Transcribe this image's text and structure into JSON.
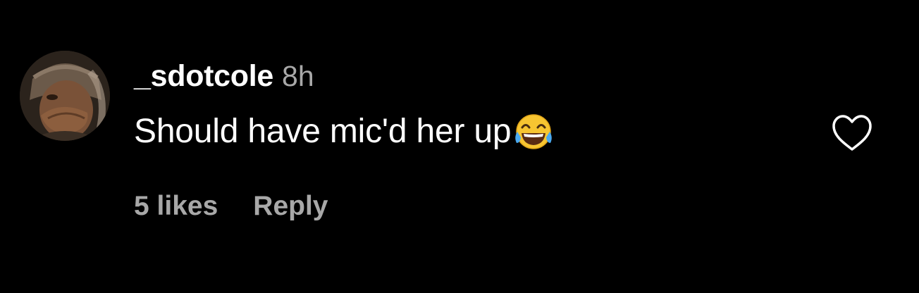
{
  "comment": {
    "author": {
      "username": "_sdotcole",
      "avatar_icon": "user-avatar"
    },
    "timestamp": "8h",
    "text": "Should have mic'd her up",
    "emoji": "face-with-tears-of-joy-icon",
    "likes_label": "5 likes",
    "reply_label": "Reply",
    "like_icon": "heart-outline-icon"
  },
  "colors": {
    "background": "#000000",
    "primary_text": "#ffffff",
    "secondary_text": "#a8a8a8"
  }
}
